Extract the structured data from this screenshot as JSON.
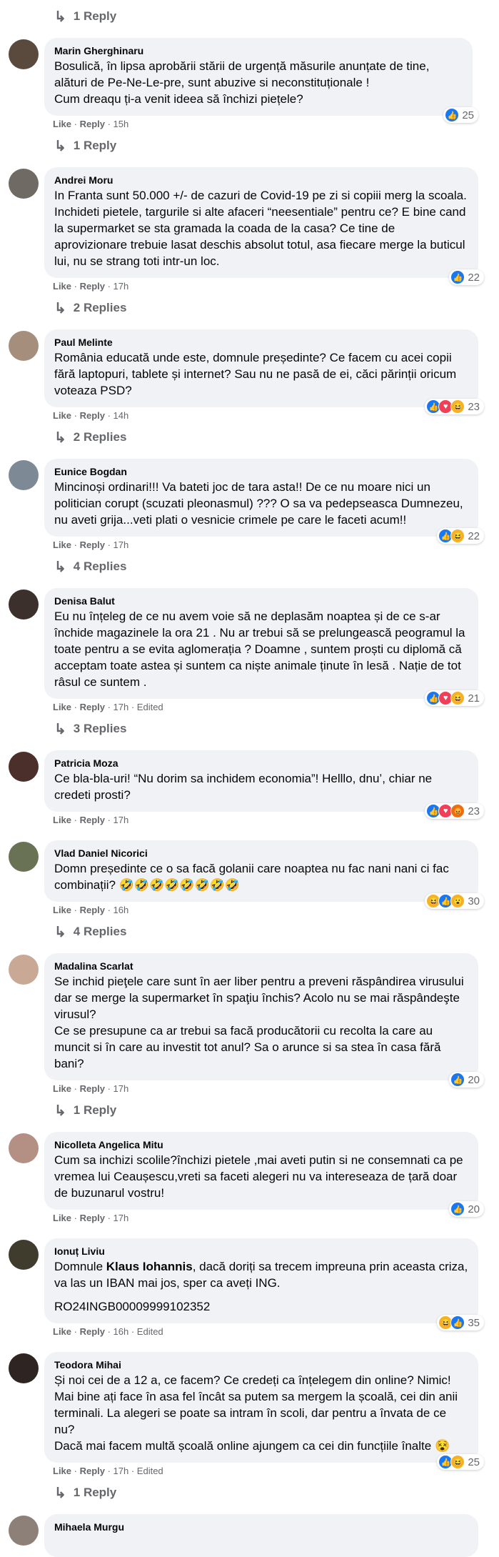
{
  "top_reply": {
    "label": "1 Reply"
  },
  "comments": [
    {
      "author": "Marin Gherghinaru",
      "text": "Bosulică, în lipsa aprobării stării de urgență măsurile anunțate de tine, alături de Pe-Ne-Le-pre, sunt abuzive si neconstituționale !\nCum dreaqu ți-a venit ideea să închizi piețele?",
      "like": "Like",
      "reply": "Reply",
      "time": "15h",
      "reactions": [
        "like"
      ],
      "count": "25",
      "replies": "1 Reply",
      "avatar_color": "#5a4a3e"
    },
    {
      "author": "Andrei Moru",
      "text": "In Franta sunt 50.000 +/- de cazuri de Covid-19 pe zi si copiii merg la scoala. Inchideti pietele, targurile si alte afaceri “neesentiale” pentru ce? E bine cand la supermarket se sta gramada la coada de la casa? Ce tine de aprovizionare trebuie lasat deschis absolut totul, asa fiecare merge la buticul lui, nu se strang toti intr-un loc.",
      "like": "Like",
      "reply": "Reply",
      "time": "17h",
      "reactions": [
        "like"
      ],
      "count": "22",
      "replies": "2 Replies",
      "avatar_color": "#6f6a63"
    },
    {
      "author": "Paul Melinte",
      "text": "România educată unde este, domnule președinte? Ce facem cu acei copii fără laptopuri, tablete și internet? Sau nu ne pasă de ei, căci părinții oricum voteaza PSD?",
      "like": "Like",
      "reply": "Reply",
      "time": "14h",
      "reactions": [
        "like",
        "love",
        "haha"
      ],
      "count": "23",
      "replies": "2 Replies",
      "avatar_color": "#a58e7c"
    },
    {
      "author": "Eunice Bogdan",
      "text": "Mincinoși ordinari!!! Va bateti joc de tara asta!! De ce nu moare nici un politician corupt (scuzati pleonasmul) ??? O sa va pedepseasca Dumnezeu, nu aveti grija...veti plati o vesnicie crimele pe care le faceti acum!!",
      "like": "Like",
      "reply": "Reply",
      "time": "17h",
      "reactions": [
        "like",
        "haha"
      ],
      "count": "22",
      "replies": "4 Replies",
      "avatar_color": "#7d8a96"
    },
    {
      "author": "Denisa Balut",
      "text": "Eu nu înțeleg de ce nu avem voie să ne deplasăm noaptea și de ce s-ar închide magazinele la ora 21 . Nu ar trebui să se prelungească peogramul la toate pentru a se evita aglomerația ? Doamne , suntem proști cu diplomă că acceptam toate astea și suntem ca niște animale ținute în lesă . Nație de tot râsul ce suntem .",
      "like": "Like",
      "reply": "Reply",
      "time": "17h · Edited",
      "reactions": [
        "like",
        "love",
        "haha"
      ],
      "count": "21",
      "replies": "3 Replies",
      "avatar_color": "#3b302b"
    },
    {
      "author": "Patricia Moza",
      "text": "Ce bla-bla-uri! “Nu dorim sa inchidem economia”! Helllo, dnu’, chiar ne credeti prosti?",
      "like": "Like",
      "reply": "Reply",
      "time": "17h",
      "reactions": [
        "like",
        "love",
        "angry"
      ],
      "count": "23",
      "replies": "",
      "avatar_color": "#4a2f2a"
    },
    {
      "author": "Vlad Daniel Nicorici",
      "text": "Domn președinte ce o sa facă golanii care noaptea nu fac nani nani ci fac combinații? 🤣🤣🤣🤣🤣🤣🤣🤣",
      "like": "Like",
      "reply": "Reply",
      "time": "16h",
      "reactions": [
        "haha",
        "like",
        "wow"
      ],
      "count": "30",
      "replies": "4 Replies",
      "avatar_color": "#6a7256"
    },
    {
      "author": "Madalina Scarlat",
      "text": "Se inchid pieţele care sunt în aer liber pentru a preveni răspândirea virusului dar se merge la supermarket în spaţiu închis? Acolo nu se mai răspândeşte virusul?\nCe se presupune ca ar trebui sa facă producătorii cu recolta la care au muncit si în care au investit tot anul? Sa o arunce si sa stea în casa fără bani?",
      "like": "Like",
      "reply": "Reply",
      "time": "17h",
      "reactions": [
        "like"
      ],
      "count": "20",
      "replies": "1 Reply",
      "avatar_color": "#c9a996"
    },
    {
      "author": "Nicolleta Angelica Mitu",
      "text": "Cum sa inchizi scolile?închizi pietele ,mai aveti putin si ne consemnati ca pe vremea lui Ceaușescu,vreti sa faceti alegeri nu va intereseaza de țară doar de buzunarul vostru!",
      "like": "Like",
      "reply": "Reply",
      "time": "17h",
      "reactions": [
        "like"
      ],
      "count": "20",
      "replies": "",
      "avatar_color": "#b48f84"
    },
    {
      "author": "Ionuț Liviu",
      "text_before": "Domnule ",
      "mention": "Klaus Iohannis",
      "text_after": ", dacă doriți sa trecem impreuna prin aceasta criza, va las un IBAN mai jos, sper ca aveți ING.",
      "text_extra": "RO24INGB00009999102352",
      "like": "Like",
      "reply": "Reply",
      "time": "16h · Edited",
      "reactions": [
        "haha",
        "like"
      ],
      "count": "35",
      "replies": "",
      "avatar_color": "#3f3b2d"
    },
    {
      "author": "Teodora Mihai",
      "text": "Și noi cei de a 12 a, ce facem? Ce credeți ca înțelegem din online? Nimic! Mai bine ați face în asa fel încât sa putem sa mergem la școală, cei din anii terminali. La alegeri se poate sa intram în scoli, dar pentru a învata de ce nu?\nDacă mai facem multă școală online ajungem ca cei din funcțiile înalte 😵",
      "like": "Like",
      "reply": "Reply",
      "time": "17h · Edited",
      "reactions": [
        "like",
        "haha"
      ],
      "count": "25",
      "replies": "1 Reply",
      "avatar_color": "#2e2522"
    },
    {
      "author": "Mihaela Murgu",
      "text": "",
      "like": "",
      "reply": "",
      "time": "",
      "reactions": [],
      "count": "",
      "replies": "",
      "avatar_color": "#8c8078"
    }
  ],
  "icons": {
    "reply_arrow": "reply-arrow-icon",
    "like": "like-reaction-icon",
    "love": "love-reaction-icon",
    "haha": "haha-reaction-icon",
    "wow": "wow-reaction-icon",
    "angry": "angry-reaction-icon"
  },
  "colors": {
    "like": "#1877f2",
    "love": "#f33e58",
    "haha": "#f7b125",
    "angry": "#e9710f",
    "bubble": "#f0f2f5",
    "meta": "#65676b"
  }
}
